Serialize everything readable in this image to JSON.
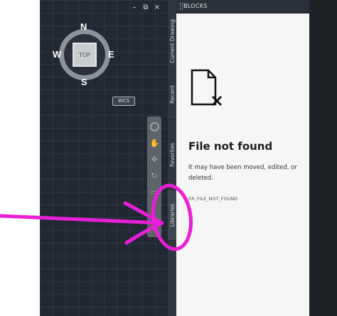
{
  "viewcube": {
    "top_label": "TOP",
    "north": "N",
    "south": "S",
    "east": "E",
    "west": "W",
    "coord_system": "WCS"
  },
  "window_controls": {
    "close_icon": "×",
    "restore_icon": "⧉",
    "minimize_icon": "–"
  },
  "palette": {
    "title": "BLOCKS",
    "tabs": [
      "Current Drawing",
      "Recent",
      "Favorites",
      "Libraries"
    ],
    "active_tab": "Libraries",
    "error": {
      "title": "File not found",
      "message": "It may have been moved, edited, or deleted.",
      "code": "ER_FILE_NOT_FOUND"
    }
  },
  "colors": {
    "annotation": "#e81fd6",
    "canvas": "#212833",
    "palette_bg": "#f6f6f6"
  }
}
